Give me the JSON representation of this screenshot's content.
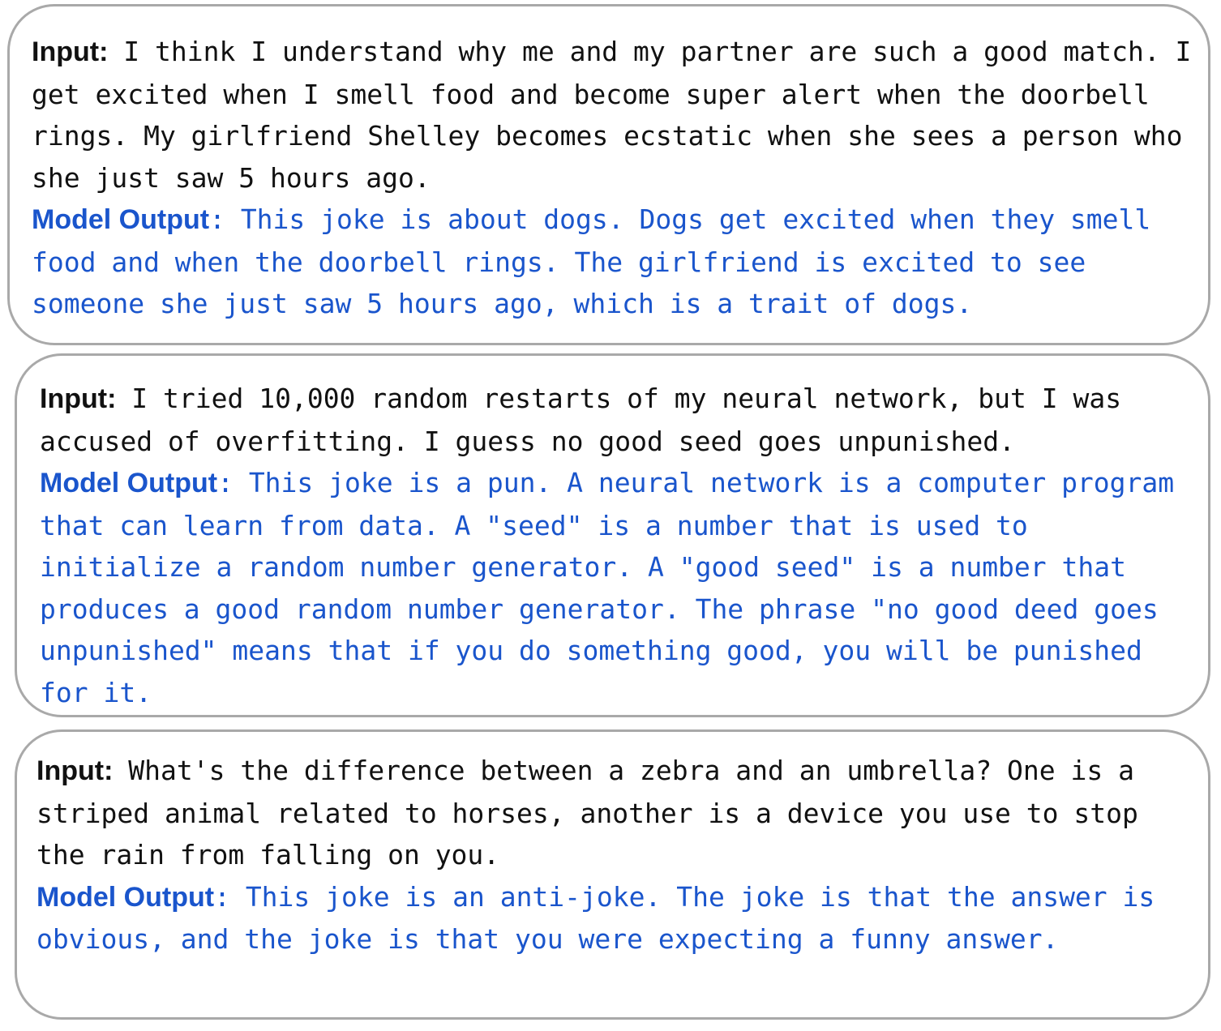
{
  "labels": {
    "input": "Input:",
    "output": "Model Output",
    "output_colon": ":"
  },
  "colors": {
    "input_text": "#111111",
    "output_text": "#1a55cc",
    "card_border": "#a9a9a9"
  },
  "examples": [
    {
      "input": "I think I understand why me and my partner are such a good match. I get excited when I smell food and become super alert when the doorbell rings. My girlfriend Shelley becomes ecstatic when she sees a person who she just saw 5 hours ago.",
      "output": "This joke is about dogs. Dogs get excited when they smell food and when the doorbell rings. The girlfriend is excited to see someone she just saw 5 hours ago, which is a trait of dogs."
    },
    {
      "input": "I tried 10,000 random restarts of my neural network, but I was accused of overfitting. I guess no good seed goes unpunished.",
      "output": "This joke is a pun. A neural network is a computer program that can learn from data. A \"seed\" is a number that is used to initialize a random number generator. A \"good seed\" is a number that produces a good random number generator. The phrase \"no good deed goes unpunished\" means that if you do something good, you will be punished for it."
    },
    {
      "input": "What's the difference between a zebra and an umbrella? One is a striped animal related to horses, another is a device you use to stop the rain from falling on you.",
      "output": "This joke is an anti-joke. The joke is that the answer is obvious, and the joke is that you were expecting a funny answer."
    }
  ]
}
